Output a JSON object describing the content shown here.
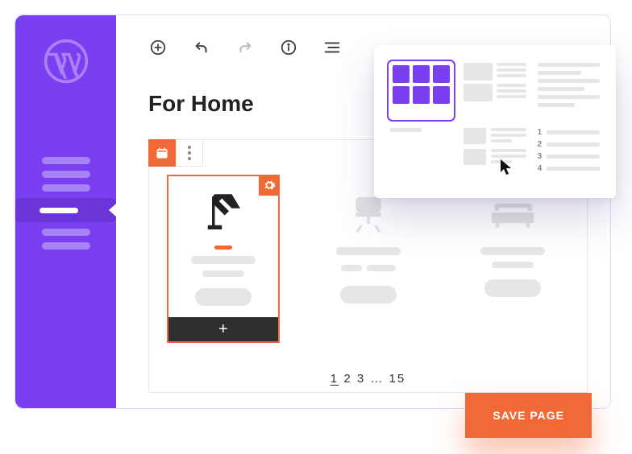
{
  "sidebar": {
    "logo": "wordpress",
    "items": [
      {
        "active": false
      },
      {
        "active": false
      },
      {
        "active": false
      },
      {
        "active": true
      },
      {
        "active": false
      },
      {
        "active": false
      }
    ]
  },
  "toolbar": {
    "add": "add",
    "undo": "undo",
    "redo": "redo",
    "info": "info",
    "outline": "outline"
  },
  "page_title": "For Home",
  "block_toolbar": {
    "preview_tab": "preview",
    "more_tab": "more"
  },
  "cards": [
    {
      "icon": "lamp",
      "selected": true,
      "gear": "settings",
      "add_label": "+"
    },
    {
      "icon": "chair",
      "selected": false
    },
    {
      "icon": "sofa",
      "selected": false
    }
  ],
  "pagination": {
    "current": "1",
    "pages": [
      "1",
      "2",
      "3"
    ],
    "ellipsis": "…",
    "last": "15"
  },
  "layout_picker": {
    "options": [
      "grid-6",
      "two-col-text",
      "row-lines",
      "masonry",
      "img-text-rows",
      "numbered-list"
    ],
    "numbered_list": [
      "1",
      "2",
      "3",
      "4"
    ],
    "selected_index": 0
  },
  "save_button": "SAVE PAGE",
  "colors": {
    "accent_purple": "#7b3ff2",
    "accent_orange": "#ef6a36"
  }
}
